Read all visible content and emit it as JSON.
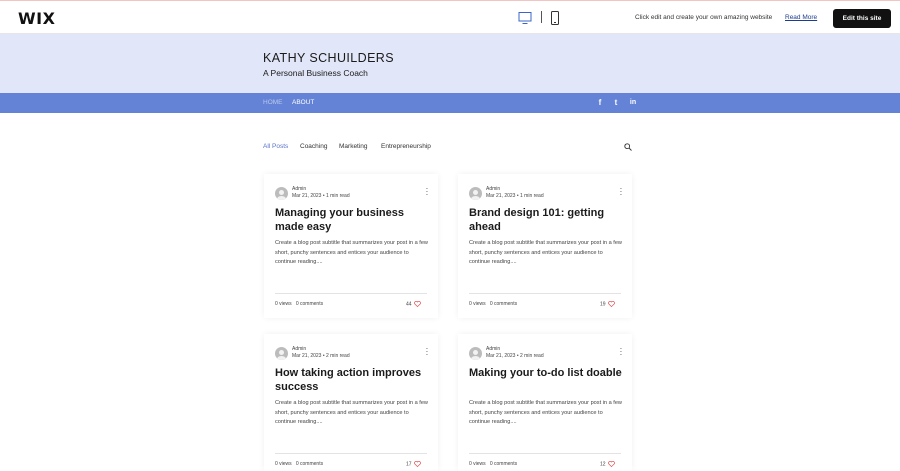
{
  "wix_bar": {
    "logo": "WIX",
    "promo_text": "Click edit and create your own amazing website",
    "read_more": "Read More",
    "edit_button": "Edit this site"
  },
  "site": {
    "title": "KATHY SCHUILDERS",
    "subtitle": "A Personal Business Coach"
  },
  "nav": {
    "items": [
      "HOME",
      "ABOUT"
    ],
    "social": [
      "facebook-icon",
      "twitter-icon",
      "linkedin-icon"
    ],
    "social_glyphs": [
      "f",
      "t",
      "in"
    ]
  },
  "categories": [
    "All Posts",
    "Coaching",
    "Marketing",
    "Entrepreneurship"
  ],
  "posts": [
    {
      "author": "Admin",
      "date": "Mar 21, 2023",
      "read_time": "1 min read",
      "title": "Managing your business made easy",
      "excerpt": "Create a blog post subtitle that summarizes your post in a few short, punchy sentences and entices your audience to continue reading....",
      "views": "0 views",
      "comments": "0 comments",
      "likes": "44"
    },
    {
      "author": "Admin",
      "date": "Mar 21, 2023",
      "read_time": "1 min read",
      "title": "Brand design 101: getting ahead",
      "excerpt": "Create a blog post subtitle that summarizes your post in a few short, punchy sentences and entices your audience to continue reading....",
      "views": "0 views",
      "comments": "0 comments",
      "likes": "19"
    },
    {
      "author": "Admin",
      "date": "Mar 21, 2023",
      "read_time": "2 min read",
      "title": "How taking action improves success",
      "excerpt": "Create a blog post subtitle that summarizes your post in a few short, punchy sentences and entices your audience to continue reading....",
      "views": "0 views",
      "comments": "0 comments",
      "likes": "17"
    },
    {
      "author": "Admin",
      "date": "Mar 21, 2023",
      "read_time": "2 min read",
      "title": "Making your to-do list doable",
      "excerpt": "Create a blog post subtitle that summarizes your post in a few short, punchy sentences and entices your audience to continue reading....",
      "views": "0 views",
      "comments": "0 comments",
      "likes": "12"
    }
  ],
  "colors": {
    "header_bg": "#e1e6f8",
    "nav_bg": "#6483d6",
    "accent": "#5a74c8",
    "heart": "#e05555"
  }
}
